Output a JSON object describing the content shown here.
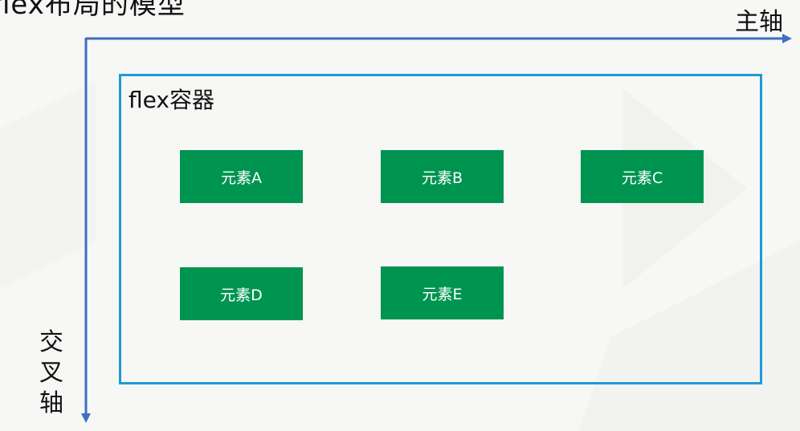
{
  "diagram": {
    "title_partial": "flex布局的模型",
    "main_axis_label": "主轴",
    "cross_axis_label": "交叉轴",
    "container_label": "flex容器",
    "items": [
      "元素A",
      "元素B",
      "元素C",
      "元素D",
      "元素E"
    ]
  },
  "colors": {
    "axis": "#3c6fc3",
    "container_border": "#1e9ad6",
    "item_fill": "#009451",
    "item_text": "#ffffff",
    "background": "#f7f7f5"
  }
}
